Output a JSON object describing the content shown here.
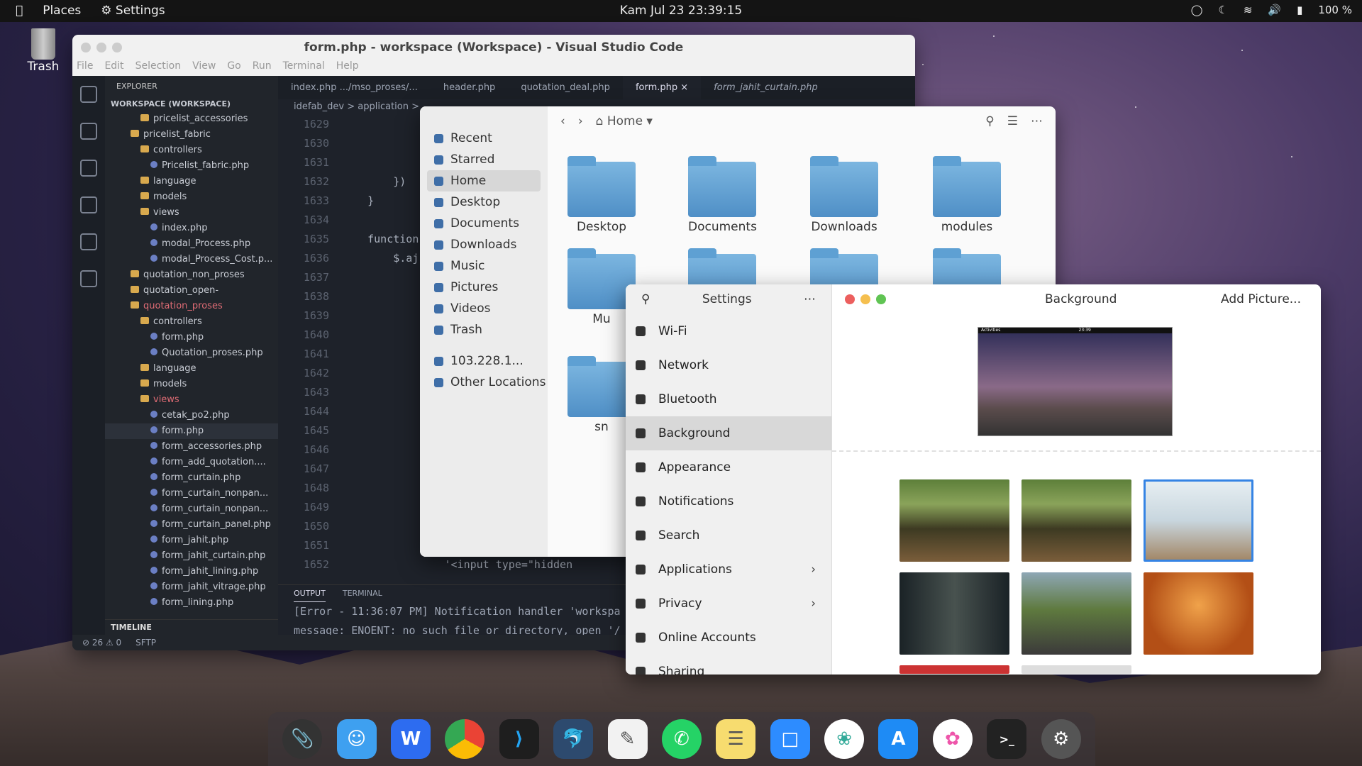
{
  "topbar": {
    "places": "Places",
    "settings": "Settings",
    "clock": "Kam Jul 23  23:39:15",
    "battery": "100 %"
  },
  "desktop": {
    "trash": "Trash"
  },
  "vscode": {
    "title": "form.php - workspace (Workspace) - Visual Studio Code",
    "menu": [
      "File",
      "Edit",
      "Selection",
      "View",
      "Go",
      "Run",
      "Terminal",
      "Help"
    ],
    "explorer": "EXPLORER",
    "workspace": "WORKSPACE (WORKSPACE)",
    "tree": [
      {
        "d": 3,
        "t": "pricelist_accessories",
        "f": 1
      },
      {
        "d": 2,
        "t": "pricelist_fabric",
        "f": 1
      },
      {
        "d": 3,
        "t": "controllers",
        "f": 1
      },
      {
        "d": 4,
        "t": "Pricelist_fabric.php"
      },
      {
        "d": 3,
        "t": "language",
        "f": 1
      },
      {
        "d": 3,
        "t": "models",
        "f": 1
      },
      {
        "d": 3,
        "t": "views",
        "f": 1
      },
      {
        "d": 4,
        "t": "index.php"
      },
      {
        "d": 4,
        "t": "modal_Process.php"
      },
      {
        "d": 4,
        "t": "modal_Process_Cost.p..."
      },
      {
        "d": 2,
        "t": "quotation_non_proses",
        "f": 1
      },
      {
        "d": 2,
        "t": "quotation_open-",
        "f": 1
      },
      {
        "d": 2,
        "t": "quotation_proses",
        "f": 1,
        "r": 1
      },
      {
        "d": 3,
        "t": "controllers",
        "f": 1
      },
      {
        "d": 4,
        "t": "form.php"
      },
      {
        "d": 4,
        "t": "Quotation_proses.php"
      },
      {
        "d": 3,
        "t": "language",
        "f": 1
      },
      {
        "d": 3,
        "t": "models",
        "f": 1
      },
      {
        "d": 3,
        "t": "views",
        "f": 1,
        "r": 1
      },
      {
        "d": 4,
        "t": "cetak_po2.php"
      },
      {
        "d": 4,
        "t": "form.php",
        "s": 1
      },
      {
        "d": 4,
        "t": "form_accessories.php"
      },
      {
        "d": 4,
        "t": "form_add_quotation...."
      },
      {
        "d": 4,
        "t": "form_curtain.php"
      },
      {
        "d": 4,
        "t": "form_curtain_nonpan..."
      },
      {
        "d": 4,
        "t": "form_curtain_nonpan..."
      },
      {
        "d": 4,
        "t": "form_curtain_panel.php"
      },
      {
        "d": 4,
        "t": "form_jahit.php"
      },
      {
        "d": 4,
        "t": "form_jahit_curtain.php"
      },
      {
        "d": 4,
        "t": "form_jahit_lining.php"
      },
      {
        "d": 4,
        "t": "form_jahit_vitrage.php"
      },
      {
        "d": 4,
        "t": "form_lining.php"
      }
    ],
    "tabs": [
      "index.php .../mso_proses/...",
      "header.php",
      "quotation_deal.php",
      "form.php",
      "form_jahit_curtain.php"
    ],
    "breadcrumb": "idefab_dev > application >",
    "lines": [
      "1629",
      "1630",
      "1631",
      "1632",
      "1633",
      "1634",
      "1635",
      "1636",
      "1637",
      "1638",
      "1639",
      "1640",
      "1641",
      "1642",
      "1643",
      "1644",
      "1645",
      "1646",
      "1647",
      "1648",
      "1649",
      "1650",
      "1651",
      "1652"
    ],
    "code": [
      "",
      "",
      "",
      "        })",
      "    }",
      "",
      "    function",
      "        $.aj",
      "",
      "",
      "",
      "",
      "",
      "",
      "",
      "",
      "",
      "",
      "",
      "",
      "",
      "",
      "",
      "                '<input type=\"hidden"
    ],
    "panel_tabs": [
      "OUTPUT",
      "TERMINAL"
    ],
    "output": [
      "[Error - 11:36:07 PM] Notification handler 'workspa",
      "message: ENOENT: no such file or directory, open '/"
    ],
    "timeline": "TIMELINE",
    "status": [
      "⊘ 26 ⚠ 0",
      "SFTP"
    ]
  },
  "files": {
    "path": "Home",
    "sidebar": [
      "Recent",
      "Starred",
      "Home",
      "Desktop",
      "Documents",
      "Downloads",
      "Music",
      "Pictures",
      "Videos",
      "Trash",
      "103.228.1...",
      "Other Locations"
    ],
    "folders": [
      "Desktop",
      "Documents",
      "Downloads",
      "modules",
      "Mu",
      "sn"
    ]
  },
  "settings": {
    "title": "Settings",
    "panel_title": "Background",
    "add_picture": "Add Picture...",
    "items": [
      "Wi-Fi",
      "Network",
      "Bluetooth",
      "Background",
      "Appearance",
      "Notifications",
      "Search",
      "Applications",
      "Privacy",
      "Online Accounts",
      "Sharing"
    ],
    "preview_activities": "Activities",
    "preview_time": "23:39"
  },
  "dock": {
    "apps": [
      "clip",
      "finder",
      "wps",
      "chrome",
      "vscode",
      "mysql",
      "text",
      "whatsapp",
      "notes",
      "zoom",
      "fan",
      "appstore",
      "photos",
      "terminal",
      "settings"
    ]
  },
  "colors": {
    "close": "#ec5f5e",
    "min": "#f5bf4f",
    "max": "#60c453",
    "accent": "#3584e4"
  }
}
